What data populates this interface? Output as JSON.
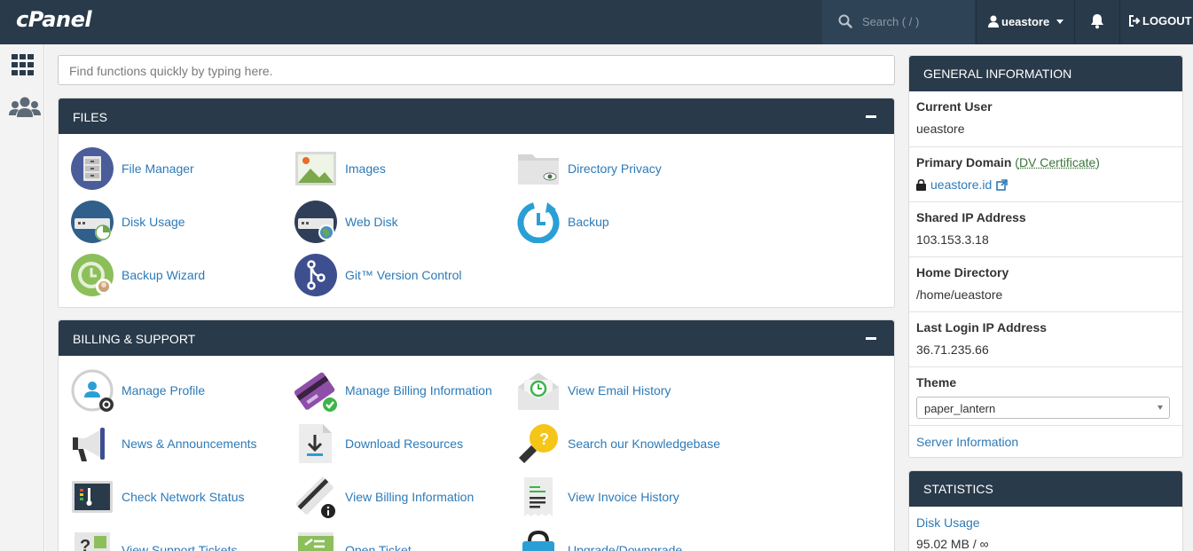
{
  "header": {
    "logo": "cPanel",
    "search_placeholder": "Search ( / )",
    "username": "ueastore",
    "logout_label": "LOGOUT"
  },
  "quick_search": {
    "placeholder": "Find functions quickly by typing here."
  },
  "files": {
    "title": "FILES",
    "items": [
      {
        "label": "File Manager"
      },
      {
        "label": "Images"
      },
      {
        "label": "Directory Privacy"
      },
      {
        "label": "Disk Usage"
      },
      {
        "label": "Web Disk"
      },
      {
        "label": "Backup"
      },
      {
        "label": "Backup Wizard"
      },
      {
        "label": "Git™ Version Control"
      }
    ]
  },
  "billing": {
    "title": "BILLING & SUPPORT",
    "items": [
      {
        "label": "Manage Profile"
      },
      {
        "label": "Manage Billing Information"
      },
      {
        "label": "View Email History"
      },
      {
        "label": "News & Announcements"
      },
      {
        "label": "Download Resources"
      },
      {
        "label": "Search our Knowledgebase"
      },
      {
        "label": "Check Network Status"
      },
      {
        "label": "View Billing Information"
      },
      {
        "label": "View Invoice History"
      },
      {
        "label": "View Support Tickets"
      },
      {
        "label": "Open Ticket"
      },
      {
        "label": "Upgrade/Downgrade"
      }
    ]
  },
  "general_info": {
    "title": "GENERAL INFORMATION",
    "current_user_label": "Current User",
    "current_user": "ueastore",
    "primary_domain_label": "Primary Domain",
    "dv_open": "(",
    "dv_text": "DV Certificate",
    "dv_close": ")",
    "primary_domain": "ueastore.id",
    "shared_ip_label": "Shared IP Address",
    "shared_ip": "103.153.3.18",
    "home_dir_label": "Home Directory",
    "home_dir": "/home/ueastore",
    "last_login_label": "Last Login IP Address",
    "last_login": "36.71.235.66",
    "theme_label": "Theme",
    "theme": "paper_lantern",
    "server_info": "Server Information"
  },
  "statistics": {
    "title": "STATISTICS",
    "disk_usage_label": "Disk Usage",
    "disk_usage_value": "95.02 MB / ∞"
  }
}
